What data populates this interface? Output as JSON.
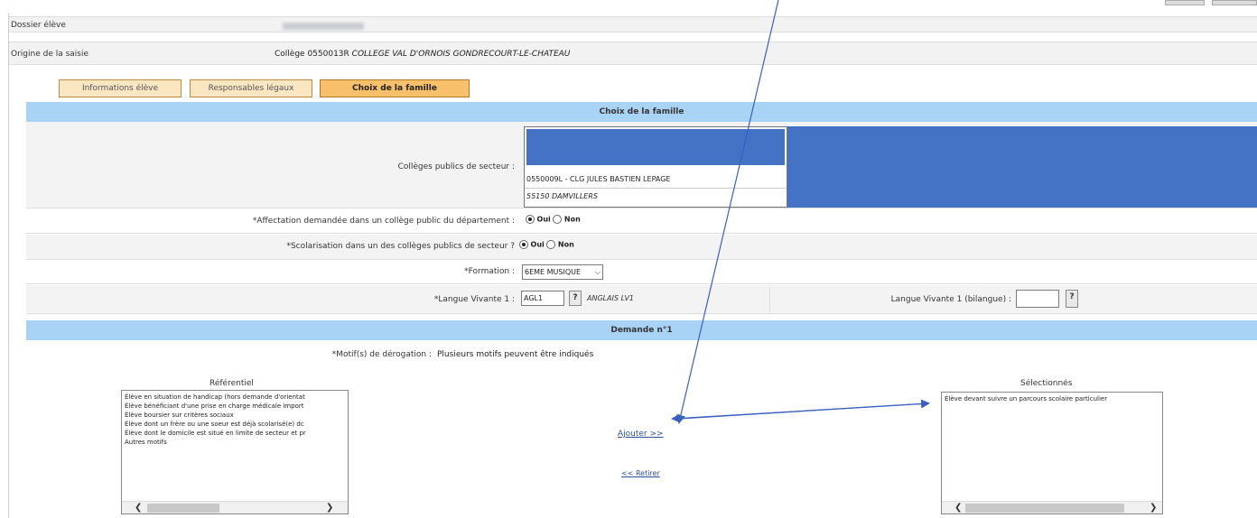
{
  "dossier": {
    "label": "Dossier élève",
    "value_blurred": true
  },
  "origine": {
    "label": "Origine de la saisie",
    "prefix": "Collège 0550013R",
    "college": "COLLEGE VAL D'ORNOIS GONDRECOURT-LE-CHATEAU"
  },
  "tabs": [
    "Informations élève",
    "Responsables légaux",
    "Choix de la famille"
  ],
  "section_title": "Choix de la famille",
  "secteur": {
    "label": "Collèges publics de secteur :",
    "option_code": "0550009L - CLG JULES BASTIEN LEPAGE",
    "option_city": "55150 DAMVILLERS",
    "highlight_color": "#4472c4"
  },
  "affectation": {
    "label": "*Affectation demandée dans un collège public du département :",
    "oui": "Oui",
    "non": "Non"
  },
  "scolarisation": {
    "label": "*Scolarisation dans un des collèges publics de secteur ?",
    "oui": "Oui",
    "non": "Non"
  },
  "formation": {
    "label": "*Formation :",
    "value": "6EME MUSIQUE"
  },
  "langue": {
    "label": "*Langue Vivante 1 :",
    "code": "AGL1",
    "btn": "?",
    "name": "ANGLAIS LV1",
    "bilangue_label": "Langue Vivante 1 (bilangue) :",
    "bilangue_btn": "?"
  },
  "demande": {
    "title": "Demande n°1"
  },
  "motifs": {
    "label": "*Motif(s) de dérogation :",
    "hint": "Plusieurs motifs peuvent être indiqués"
  },
  "referentiel": {
    "title": "Référentiel",
    "items": [
      "Élève en situation de handicap (hors demande d'orientat",
      "Élève bénéficiant d'une prise en charge médicale import",
      "Élève boursier sur critères sociaux",
      "Élève dont un frère ou une soeur est déjà scolarisé(e) dc",
      "Élève dont le domicile est situé en limite de secteur et pr",
      "Autres motifs"
    ]
  },
  "actions": {
    "add": "Ajouter >>",
    "remove": "<< Retirer"
  },
  "selectionnes": {
    "title": "Sélectionnés",
    "items": [
      "Élève devant suivre un parcours scolaire particulier"
    ]
  },
  "colors": {
    "band": "#a9d3f5",
    "arrow": "#3a5fbf",
    "tab": "#fbe6c2",
    "tab_active": "#f8c06a"
  }
}
